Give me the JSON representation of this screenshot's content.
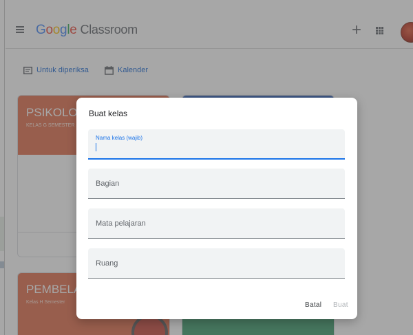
{
  "header": {
    "logo_letters": [
      "G",
      "o",
      "o",
      "g",
      "l",
      "e"
    ],
    "product": "Classroom"
  },
  "subnav": {
    "to_review": "Untuk diperiksa",
    "calendar": "Kalender"
  },
  "cards": [
    {
      "title": "PSIKOLOG",
      "subtitle": "KELAS G SEMESTER",
      "color": "#e06d4b"
    },
    {
      "title": "",
      "subtitle": "",
      "color": "#2f5fb8"
    },
    {
      "title": "PEMBELA",
      "subtitle": "Kelas H Semester",
      "color": "#e06d4b"
    },
    {
      "title": "",
      "subtitle": "",
      "color": "#3a9a6a"
    }
  ],
  "dialog": {
    "title": "Buat kelas",
    "fields": {
      "class_name_label": "Nama kelas (wajib)",
      "section": "Bagian",
      "subject": "Mata pelajaran",
      "room": "Ruang"
    },
    "cancel_label": "Batal",
    "create_label": "Buat"
  },
  "colors": {
    "accent": "#1a73e8",
    "field_bg": "#f1f3f4"
  }
}
